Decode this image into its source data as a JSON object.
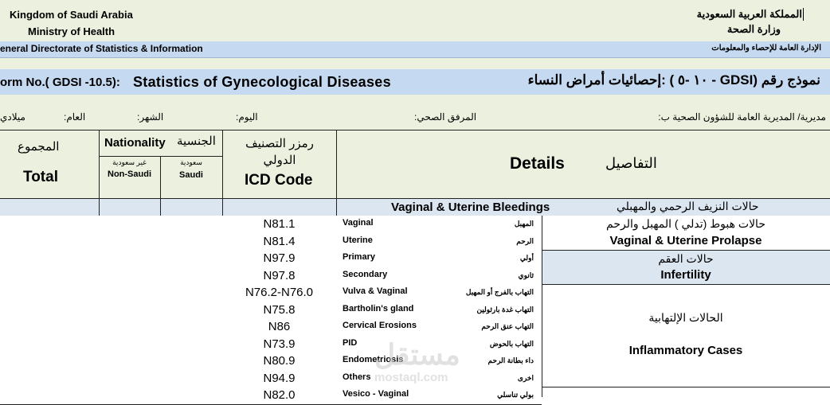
{
  "header": {
    "kingdom_en": "Kingdom of Saudi Arabia",
    "ministry_en": "Ministry of Health",
    "kingdom_ar": "المملكة العربية السعودية",
    "ministry_ar": "وزارة الصحة",
    "directorate_en": "eneral  Directorate of Statistics & Information",
    "directorate_ar": "الإدارة العامة للإحصاء والمعلومات"
  },
  "form": {
    "form_no_en": "orm No.( GDSI -10.5):",
    "title_en": "Statistics of Gynecological Diseases",
    "title_ar": "نموذج رقم (GDSI - ١٠ -٥ ) :إحصائيات أمراض النساء"
  },
  "info_row": {
    "directorate_ar": "مديرية/ المديرية العامة للشؤون الصحية ب:",
    "facility_ar": "المرفق الصحي:",
    "day_ar": "اليوم:",
    "month_ar": "الشهر:",
    "year_ar": "العام:",
    "calendar_ar": "ميلادي"
  },
  "table_header": {
    "total_ar": "المجموع",
    "total_en": "Total",
    "nationality_en": "Nationality",
    "nationality_ar": "الجنسية",
    "non_saudi_ar": "غير سعودية",
    "non_saudi_en": "Non-Saudi",
    "saudi_ar": "سعودية",
    "saudi_en": "Saudi",
    "icd_ar": "رمزر التصنيف الدولي",
    "icd_en": "ICD Code",
    "details_en": "Details",
    "details_ar": "التفاصيل"
  },
  "section_bleeding": {
    "en": "Vaginal & Uterine Bleedings",
    "ar": "حالات النزيف الرحمي والمهبلي"
  },
  "groups": [
    {
      "ar": "حالات هبوط (تدلي ) المهبل والرحم",
      "en": "Vaginal & Uterine Prolapse"
    },
    {
      "ar": "حالات العقم",
      "en": "Infertility"
    },
    {
      "ar": "الحالات الإلتهابية",
      "en": "Inflammatory   Cases"
    }
  ],
  "rows": [
    {
      "icd": "N81.1",
      "en": "Vaginal",
      "ar": "المهبل"
    },
    {
      "icd": "N81.4",
      "en": "Uterine",
      "ar": "الرحم"
    },
    {
      "icd": "N97.9",
      "en": "Primary",
      "ar": "أولي"
    },
    {
      "icd": "N97.8",
      "en": "Secondary",
      "ar": "ثانوي"
    },
    {
      "icd": "N76.2-N76.0",
      "en": "Vulva & Vaginal",
      "ar": "التهاب بالفرج أو المهبل"
    },
    {
      "icd": "N75.8",
      "en": "Bartholin's gland",
      "ar": "التهاب غدة بارثولين"
    },
    {
      "icd": "N86",
      "en": "Cervical Erosions",
      "ar": "التهاب عنق الرحم"
    },
    {
      "icd": "N73.9",
      "en": "PID",
      "ar": "التهاب بالحوض"
    },
    {
      "icd": "N80.9",
      "en": "Endometriosis",
      "ar": "داء بطانة الرحم"
    },
    {
      "icd": "N94.9",
      "en": "Others",
      "ar": "اخرى"
    },
    {
      "icd": "N82.0",
      "en": "Vesico - Vaginal",
      "ar": "بولي تناسلي"
    }
  ],
  "colors": {
    "green_band": "#ebf1de",
    "blue_band": "#c5d9f1",
    "grid": "#222222"
  }
}
